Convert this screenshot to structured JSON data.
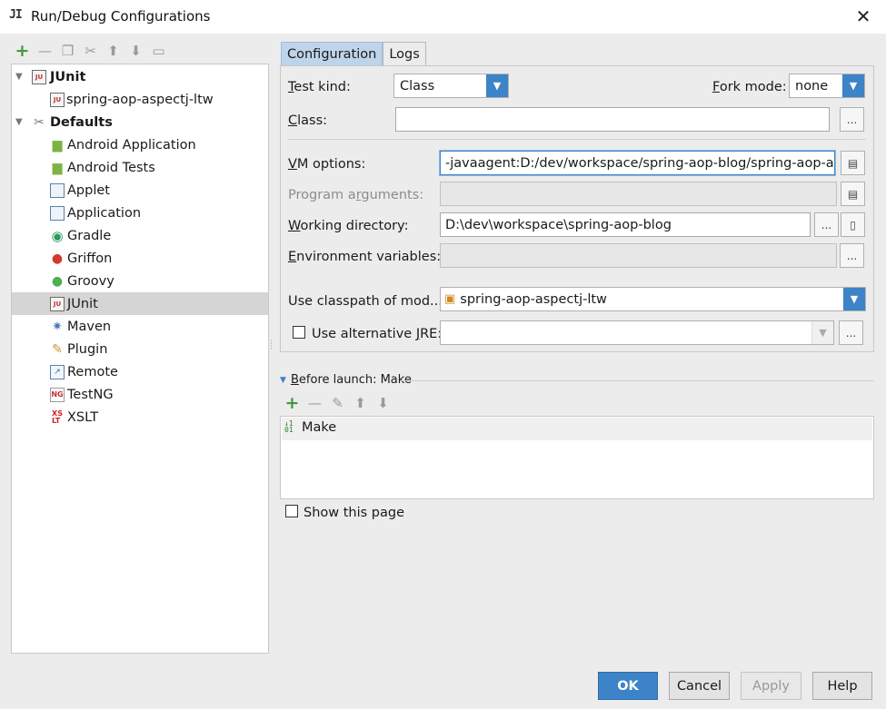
{
  "window": {
    "title": "Run/Debug Configurations",
    "app_icon": "JI"
  },
  "toolbar": {
    "icons": [
      "add-icon",
      "remove-icon",
      "copy-icon",
      "edit-defaults-icon",
      "move-up-icon",
      "move-down-icon",
      "folder-icon"
    ]
  },
  "tree": {
    "junit_group": "JUnit",
    "junit_config": "spring-aop-aspectj-ltw",
    "defaults_group": "Defaults",
    "items": [
      "Android Application",
      "Android Tests",
      "Applet",
      "Application",
      "Gradle",
      "Griffon",
      "Groovy",
      "JUnit",
      "Maven",
      "Plugin",
      "Remote",
      "TestNG",
      "XSLT"
    ],
    "selected": "JUnit"
  },
  "tabs": {
    "configuration": "Configuration",
    "logs": "Logs",
    "active": "Configuration"
  },
  "form": {
    "test_kind_label_u": "T",
    "test_kind_label_rest": "est kind:",
    "test_kind_value": "Class",
    "fork_mode_label_u": "F",
    "fork_mode_label_rest": "ork mode:",
    "fork_mode_value": "none",
    "class_label_u": "C",
    "class_label_rest": "lass:",
    "class_value": "",
    "vm_options_label_u": "V",
    "vm_options_label_rest": "M options:",
    "vm_options_value": "-javaagent:D:/dev/workspace/spring-aop-blog/spring-aop-aspe",
    "program_args_label_pre": "Program a",
    "program_args_label_u": "r",
    "program_args_label_rest": "guments:",
    "program_args_value": "",
    "working_dir_label_u": "W",
    "working_dir_label_rest": "orking directory:",
    "working_dir_value": "D:\\dev\\workspace\\spring-aop-blog",
    "env_vars_label_u": "E",
    "env_vars_label_rest": "nvironment variables:",
    "env_vars_value": "",
    "classpath_label": "Use classpath of mod...",
    "classpath_value": "spring-aop-aspectj-ltw",
    "alt_jre_label_pre": "Use alternative ",
    "alt_jre_label_u": "J",
    "alt_jre_label_rest": "RE:",
    "alt_jre_checked": false,
    "alt_jre_value": "",
    "ellipsis": "..."
  },
  "before_launch": {
    "header_u": "B",
    "header_rest": "efore launch: Make",
    "items": [
      "Make"
    ]
  },
  "show_page": {
    "label": "Show this page",
    "checked": false
  },
  "buttons": {
    "ok": "OK",
    "cancel": "Cancel",
    "apply": "Apply",
    "help": "Help"
  },
  "colors": {
    "accent": "#3d83c7",
    "selected_row": "#d5d5d5",
    "tab_active": "#bed4ea"
  }
}
